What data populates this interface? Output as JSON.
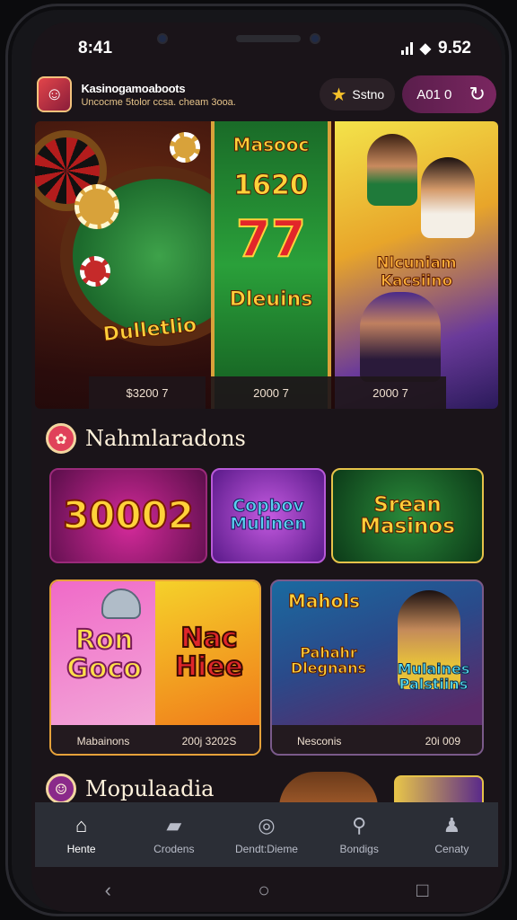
{
  "status_bar": {
    "time": "8:41",
    "battery": "9.52"
  },
  "header": {
    "title": "Kasinogamoaboots",
    "subtitle": "Uncocme 5tolor ccsa. cheam 3ooa.",
    "star_label": "Sstno",
    "account_label": "A01 0"
  },
  "featured": {
    "cards": [
      {
        "logo": "Dulletlio",
        "amount": "$3200 7"
      },
      {
        "title": "Masooc",
        "number": "1620",
        "symbol": "77",
        "logo": "Dleuins",
        "amount": "2000 7"
      },
      {
        "logo": "Nlcuniam Kacsiino",
        "amount": "2000 7"
      }
    ]
  },
  "section1": {
    "title": "Nahmlaradons"
  },
  "tiles_row1": [
    {
      "title": "30002"
    },
    {
      "title": "Copbov Mulinen"
    },
    {
      "title": "Srean Masinos"
    }
  ],
  "tiles_row2": [
    {
      "title_left": "Ron Goco",
      "title_right": "Nac Hiee",
      "label_left": "Mabainons",
      "label_right": "200j 3202S"
    },
    {
      "title_top": "Mahols",
      "title_mid": "Pahahr Dlegnans",
      "title_right": "Mulaines Palstiins",
      "label_left": "Nesconis",
      "label_right": "20i 009"
    }
  ],
  "section2": {
    "title": "Mopulaadia"
  },
  "bottom_nav": [
    {
      "label": "Hente",
      "icon": "home-icon"
    },
    {
      "label": "Crodens",
      "icon": "cards-icon"
    },
    {
      "label": "Dendt:Dieme",
      "icon": "chip-icon"
    },
    {
      "label": "Bondigs",
      "icon": "search-icon"
    },
    {
      "label": "Cenaty",
      "icon": "person-icon"
    }
  ],
  "colors": {
    "accent": "#7a2660",
    "nav_bg": "#2b2e36",
    "screen_bg": "#1a1419"
  }
}
